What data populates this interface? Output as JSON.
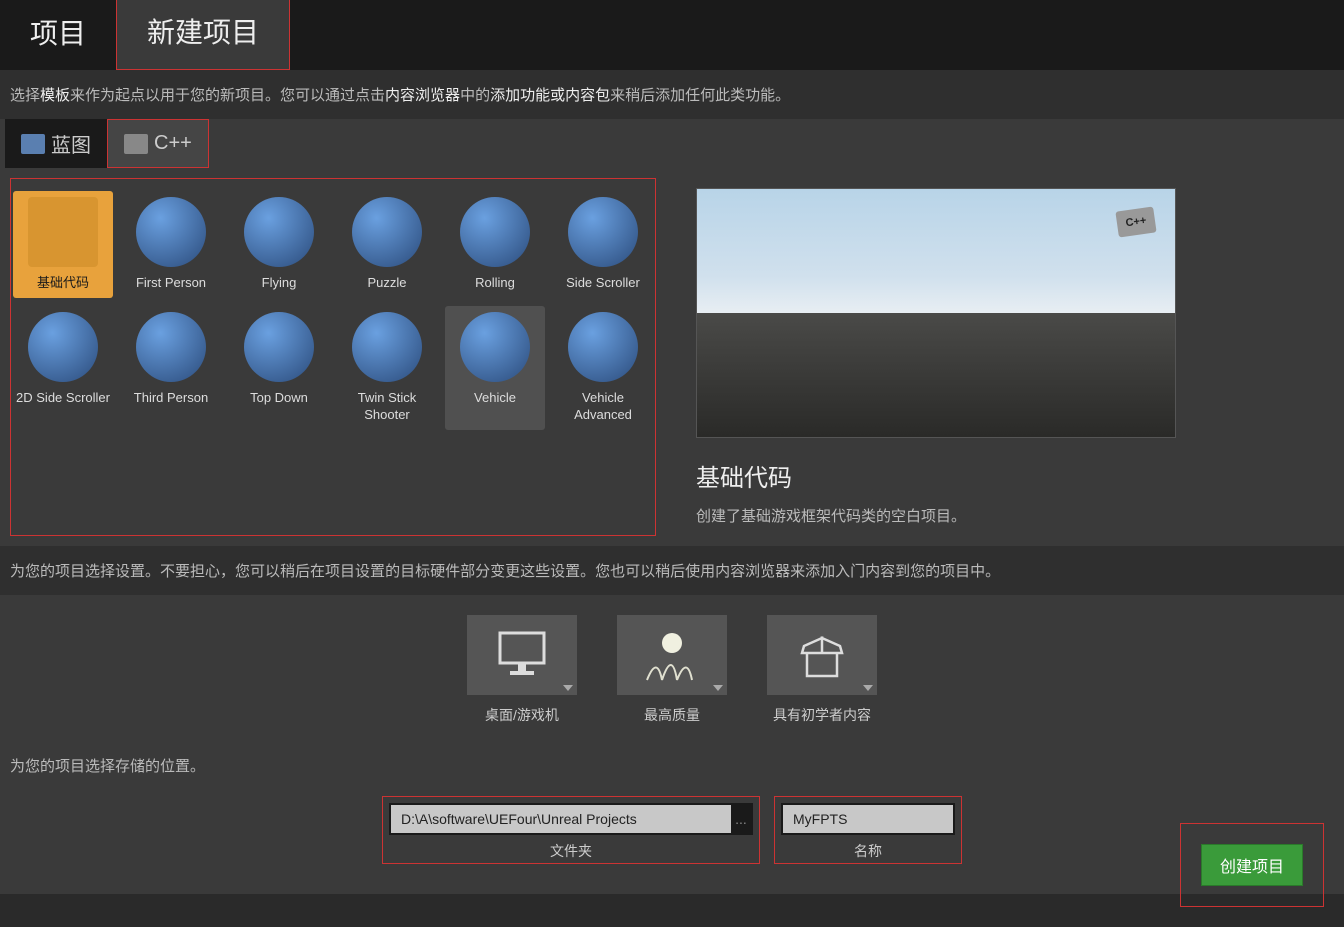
{
  "tabs": {
    "projects": "项目",
    "new_project": "新建项目"
  },
  "info": {
    "prefix": "选择",
    "template": "模板",
    "mid1": "来作为起点以用于您的新项目。您可以通过点击",
    "browser": "内容浏览器",
    "mid2": "中的",
    "addfeat": "添加功能或内容包",
    "suffix": "来稍后添加任何此类功能。"
  },
  "subtabs": {
    "blueprint": "蓝图",
    "cpp": "C++"
  },
  "templates": [
    {
      "label": "基础代码",
      "selected": true
    },
    {
      "label": "First Person"
    },
    {
      "label": "Flying"
    },
    {
      "label": "Puzzle"
    },
    {
      "label": "Rolling"
    },
    {
      "label": "Side Scroller"
    },
    {
      "label": "2D Side Scroller"
    },
    {
      "label": "Third Person"
    },
    {
      "label": "Top Down"
    },
    {
      "label": "Twin Stick Shooter"
    },
    {
      "label": "Vehicle",
      "hover": true
    },
    {
      "label": "Vehicle Advanced"
    }
  ],
  "preview": {
    "badge": "C++",
    "title": "基础代码",
    "desc": "创建了基础游戏框架代码类的空白项目。"
  },
  "settings_info": {
    "prefix": "为您的项目选择",
    "settings": "设置",
    "mid1": "。不要担心，您可以稍后在",
    "projset": "项目设置",
    "mid2": "的",
    "target": "目标硬件",
    "mid3": "部分变更这些设置。您也可以稍后使用",
    "browser": "内容浏览器",
    "mid4": "来添加",
    "starter": "入门内容",
    "suffix": "到您的项目中。"
  },
  "setting_cards": {
    "platform": "桌面/游戏机",
    "quality": "最高质量",
    "starter": "具有初学者内容"
  },
  "location": {
    "prefix": "为您的项目选择存储的",
    "loc": "位置",
    "suffix": "。"
  },
  "path": {
    "folder_value": "D:\\A\\software\\UEFour\\Unreal Projects",
    "folder_label": "文件夹",
    "name_value": "MyFPTS",
    "name_label": "名称",
    "browse": "..."
  },
  "create_button": "创建项目"
}
